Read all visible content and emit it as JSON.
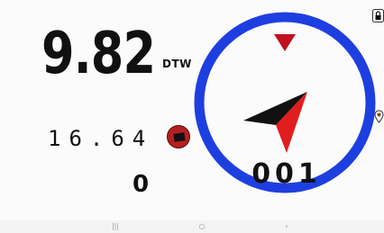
{
  "dtw": {
    "value": "9.82",
    "label": "DTW"
  },
  "secondary_value": "16.64",
  "record_button": {
    "icon": "stop-icon",
    "color": "#b51f1f"
  },
  "tertiary_value": "0",
  "compass": {
    "heading": "001",
    "ring_color": "#1e3fe0",
    "marker_color": "#c1121f",
    "arrow_dark": "#111111",
    "arrow_red": "#e01e1e"
  },
  "status_icons": {
    "top_right": "lock-icon",
    "right_edge": "location-pin-icon"
  },
  "navbar": {
    "recents": "|||",
    "home": "○",
    "back": "‹"
  }
}
